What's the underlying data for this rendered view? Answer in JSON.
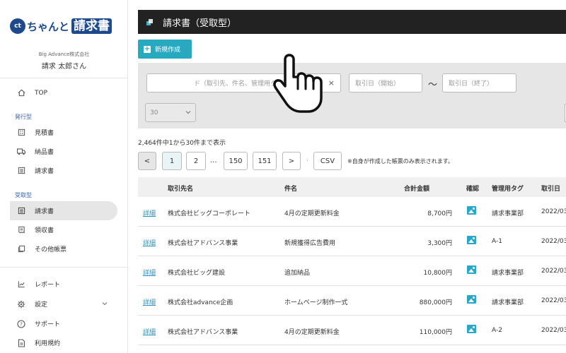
{
  "sidebar": {
    "logo_mark": "ct",
    "logo_text1": "ちゃんと",
    "logo_text2": "請求書",
    "company": "Big Advance株式会社",
    "user": "請求 太郎さん",
    "top_label": "TOP",
    "section_issue": "発行型",
    "issue_items": [
      "見積書",
      "納品書",
      "請求書"
    ],
    "section_receive": "受取型",
    "receive_items": [
      "請求書",
      "領収書",
      "その他帳票"
    ],
    "bottom_items": [
      "レポート",
      "設定",
      "サポート",
      "利用規約"
    ]
  },
  "header": {
    "title": "請求書（受取型）"
  },
  "toolbar": {
    "new_label": "新規作成"
  },
  "filter": {
    "keyword_placeholder": "ド（取引先、件名、管理用タグ）",
    "date_from_placeholder": "取引日（開始）",
    "date_to_placeholder": "取引日（終了）",
    "range_sep": "〜",
    "per_page_value": "30",
    "clear_glyph": "×"
  },
  "result_count": "2,464件中1から30件まで表示",
  "pagination": {
    "prev": "<",
    "pages": [
      "1",
      "2",
      "150",
      "151"
    ],
    "ellipsis": "...",
    "next": ">",
    "dot": "·",
    "csv": "CSV",
    "note": "※自身が作成した帳票のみ表示されます。"
  },
  "table": {
    "columns": [
      "取引先名",
      "件名",
      "合計金額",
      "確認",
      "管理用タグ",
      "取引日"
    ],
    "detail_label": "詳細",
    "rows": [
      {
        "partner": "株式会社ビッグコーポレート",
        "subject": "4月の定期更新料金",
        "amount": "8,700円",
        "tag": "請求事業部",
        "date": "2022/03"
      },
      {
        "partner": "株式会社アドバンス事業",
        "subject": "新規獲得広告費用",
        "amount": "3,300円",
        "tag": "A-1",
        "date": "2022/03"
      },
      {
        "partner": "株式会社ビッグ建設",
        "subject": "追加納品",
        "amount": "10,800円",
        "tag": "請求事業部",
        "date": "2022/03"
      },
      {
        "partner": "株式会社advance企画",
        "subject": "ホームページ制作一式",
        "amount": "880,000円",
        "tag": "請求事業部",
        "date": "2022/03"
      },
      {
        "partner": "株式会社アドバンス事業",
        "subject": "4月の定期更新料金",
        "amount": "110,000円",
        "tag": "A-2",
        "date": "2022/03"
      }
    ]
  },
  "colors": {
    "accent": "#27a9c0",
    "brand": "#1e4a8d",
    "link": "#2a8fc0",
    "header_bg": "#222222"
  }
}
